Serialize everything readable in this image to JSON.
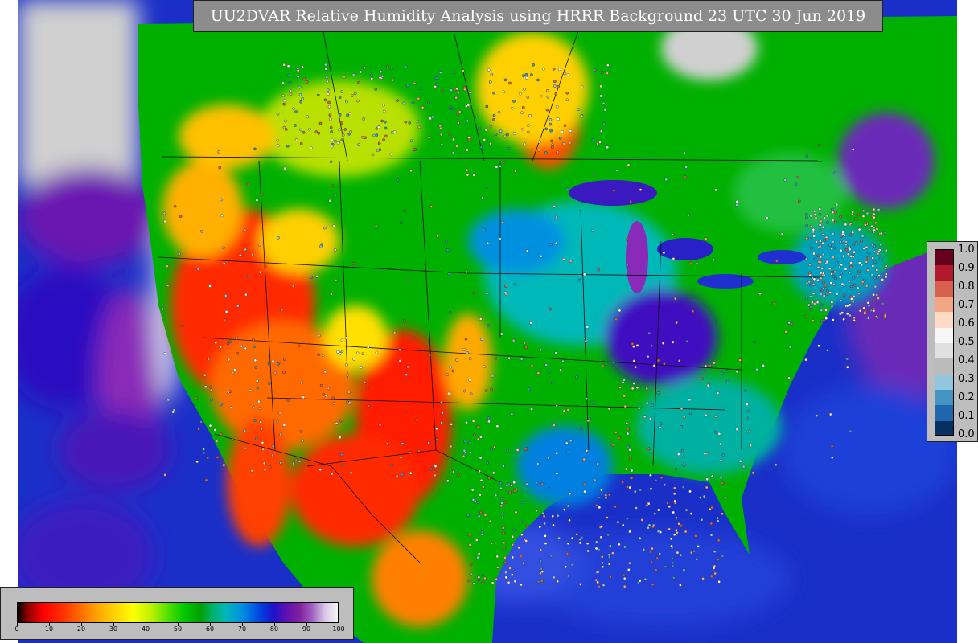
{
  "title": "UU2DVAR Relative Humidity Analysis using HRRR Background 23 UTC 30 Jun 2019",
  "colorbar": {
    "labels": [
      "0",
      "10",
      "20",
      "30",
      "40",
      "50",
      "60",
      "70",
      "80",
      "90",
      "100"
    ]
  },
  "station_legend": {
    "labels": [
      "1.0",
      "0.9",
      "0.8",
      "0.7",
      "0.6",
      "0.5",
      "0.4",
      "0.3",
      "0.2",
      "0.1",
      "0.0"
    ],
    "colors": [
      "#67001f",
      "#b2182b",
      "#d6604d",
      "#f4a582",
      "#fddbc7",
      "#f7f7f7",
      "#e0e0e0",
      "#bababa",
      "#92c5de",
      "#4393c3",
      "#2166ac",
      "#053061"
    ]
  },
  "map_colors": {
    "ocean": "#1a2fc8",
    "land_moist": "#00b000",
    "land_dry": "#ff2a00",
    "land_med": "#ffcc00",
    "high_humidity": "#8a1eb0",
    "saturated": "#c8c8c8"
  }
}
